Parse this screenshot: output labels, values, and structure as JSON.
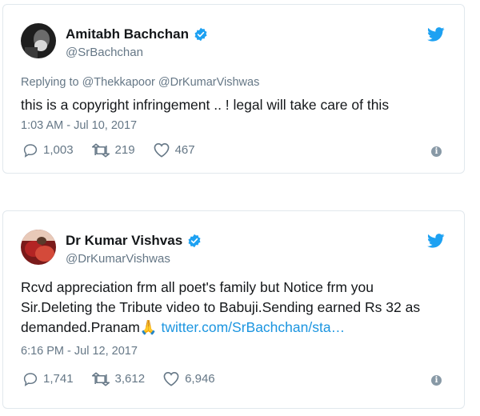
{
  "tweets": [
    {
      "name": "Amitabh Bachchan",
      "handle": "@SrBachchan",
      "replying_to": "Replying to @Thekkapoor @DrKumarVishwas",
      "text": "this is a copyright infringement .. ! legal will take care of this",
      "time": "1:03 AM - Jul 10, 2017",
      "replies": "1,003",
      "retweets": "219",
      "likes": "467",
      "avatar_icon": "avatar-photo-dark"
    },
    {
      "name": "Dr Kumar Vishvas",
      "handle": "@DrKumarVishwas",
      "text_line1": "Rcvd appreciation frm all poet's family but Notice frm you",
      "text_line2": "Sir.Deleting the Tribute video to Babuji.Sending earned Rs 32 as",
      "text_line3": "demanded.Pranam",
      "emoji": "🙏",
      "link": "twitter.com/SrBachchan/sta…",
      "time": "6:16 PM - Jul 12, 2017",
      "replies": "1,741",
      "retweets": "3,612",
      "likes": "6,946",
      "avatar_icon": "avatar-photo-red"
    }
  ],
  "colors": {
    "accent": "#1da1f2",
    "link": "#1b95e0",
    "muted": "#657786",
    "border": "#e1e8ed"
  },
  "icons": [
    "verified-badge-icon",
    "twitter-bird-icon",
    "reply-icon",
    "retweet-icon",
    "like-heart-icon",
    "info-icon"
  ],
  "info_glyph": "i"
}
